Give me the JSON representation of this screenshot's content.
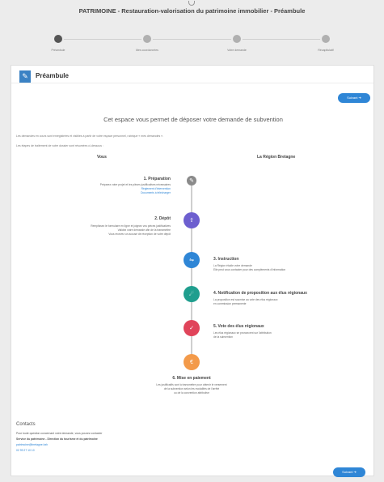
{
  "header": {
    "title": "PATRIMOINE - Restauration-valorisation du patrimoine immobilier - Préambule"
  },
  "stepper": {
    "steps": [
      {
        "label": "Préambule",
        "active": true
      },
      {
        "label": "Mes coordonnées",
        "active": false
      },
      {
        "label": "Votre demande",
        "active": false
      },
      {
        "label": "Récapitulatif",
        "active": false
      }
    ]
  },
  "card": {
    "title": "Préambule",
    "next_top": "Suivant",
    "next_bottom": "Suivant",
    "intro": "Cet espace vous permet de déposer votre demande de subvention",
    "note1": "Les demandes en cours sont enregistrées et visibles à partir de votre espace personnel, rubrique « mes demandes ».",
    "note2": "Les étapes de traitement de votre dossier sont résumées ci-dessous :",
    "col_left": "Vous",
    "col_right": "La Région Bretagne"
  },
  "timeline": [
    {
      "title": "1. Préparation",
      "lines": [
        "Préparez votre projet et les pièces justificatives nécessaires"
      ],
      "links": [
        "Règlement d'intervention",
        "Documents à télécharger"
      ],
      "color": "#8a8a8a",
      "icon": "edit-icon"
    },
    {
      "title": "2. Dépôt",
      "lines": [
        "Remplissez le formulaire en ligne et joignez vos pièces justificatives",
        "Validez votre demande afin de la transmettre",
        "Vous recevez un accusé de réception de votre dépôt"
      ],
      "links": [],
      "color": "#6d5fcf",
      "icon": "upload-icon"
    },
    {
      "title": "3. Instruction",
      "lines": [
        "La Région étudie votre demande",
        "Elle peut vous contacter pour des compléments d'information"
      ],
      "links": [],
      "color": "#2f86d6",
      "icon": "share-icon"
    },
    {
      "title": "4. Notification de proposition aux élus régionaux",
      "lines": [
        "La proposition est soumise au vote des élus régionaux",
        "en commission permanente"
      ],
      "links": [],
      "color": "#1f9e8e",
      "icon": "megaphone-icon"
    },
    {
      "title": "5. Vote des élus régionaux",
      "lines": [
        "Les élus régionaux se prononcent sur l'attribution",
        "de la subvention"
      ],
      "links": [],
      "color": "#e0445a",
      "icon": "vote-icon"
    },
    {
      "title": "6. Mise en paiement",
      "lines": [
        "Les justificatifs sont à transmettre pour obtenir le versement",
        "de la subvention selon les modalités de l'arrêté",
        "ou de la convention attributive"
      ],
      "links": [],
      "color": "#f39a4a",
      "icon": "euro-icon"
    }
  ],
  "contacts": {
    "title": "Contacts",
    "lines": [
      "Pour toute question concernant votre demande, vous pouvez contacter",
      "Service du patrimoine - Direction du tourisme et du patrimoine",
      "patrimoine@bretagne.bzh",
      "02 99 27 10 10"
    ]
  }
}
